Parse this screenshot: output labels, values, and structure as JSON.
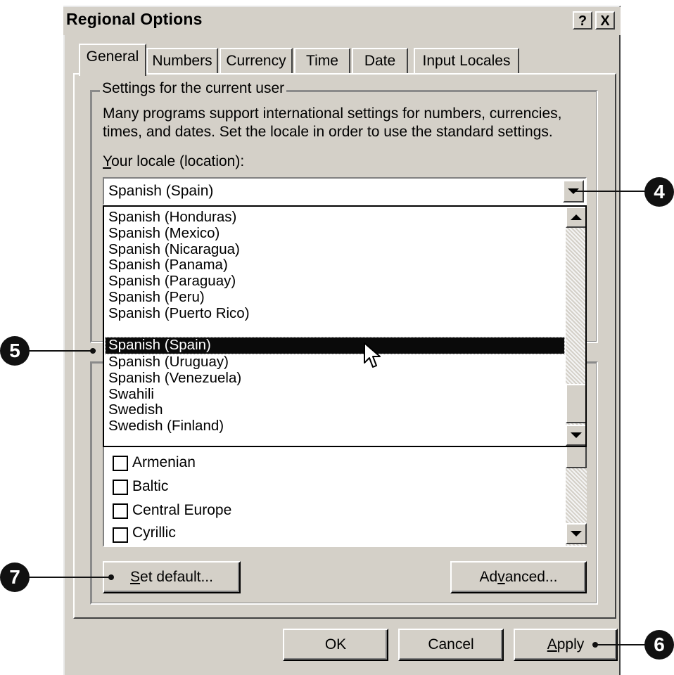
{
  "window": {
    "title": "Regional Options",
    "help_btn": "?",
    "close_btn": "X"
  },
  "tabs": [
    "General",
    "Numbers",
    "Currency",
    "Time",
    "Date",
    "Input Locales"
  ],
  "group": {
    "legend": "Settings for the current user",
    "description_line1": "Many programs support international settings for numbers, currencies,",
    "description_line2": "times, and dates. Set the locale in order to use the standard settings.",
    "locale_label_first": "Y",
    "locale_label_rest": "our locale (location):"
  },
  "locale_combo": {
    "value": "Spanish (Spain)"
  },
  "dropdown_items": [
    "Spanish (Honduras)",
    "Spanish (Mexico)",
    "Spanish (Nicaragua)",
    "Spanish (Panama)",
    "Spanish (Paraguay)",
    "Spanish (Peru)",
    "Spanish (Puerto Rico)",
    "Spanish (Spain)",
    "Spanish (Uruguay)",
    "Spanish (Venezuela)",
    "Swahili",
    "Swedish",
    "Swedish (Finland)"
  ],
  "selected_item": "Spanish (Spain)",
  "checklist": [
    "Armenian",
    "Baltic",
    "Central Europe",
    "Cyrillic"
  ],
  "buttons": {
    "set_default_u": "S",
    "set_default_rest": "et default...",
    "advanced_pre": "Ad",
    "advanced_u": "v",
    "advanced_rest": "anced...",
    "ok": "OK",
    "cancel": "Cancel",
    "apply_u": "A",
    "apply_rest": "pply"
  },
  "callouts": {
    "c4": "4",
    "c5": "5",
    "c6": "6",
    "c7": "7"
  }
}
